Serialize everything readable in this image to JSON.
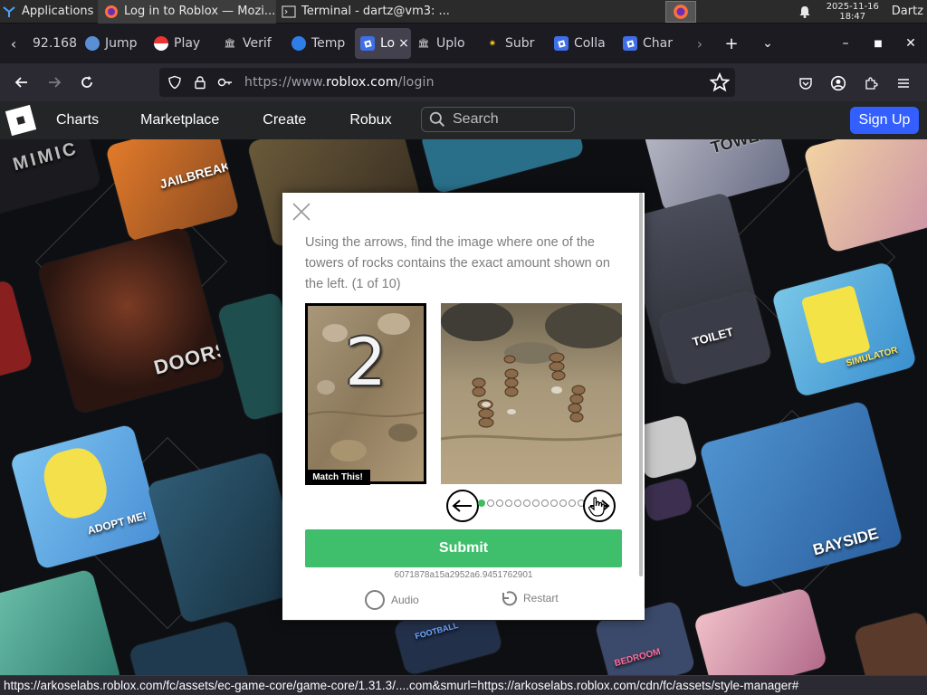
{
  "taskbar": {
    "app_menu_label": "Applications",
    "windows": [
      {
        "title": "Log in to Roblox — Mozi...",
        "icon": "firefox-icon",
        "active": true
      },
      {
        "title": "Terminal - dartz@vm3: ...",
        "icon": "terminal-icon",
        "active": false
      }
    ],
    "clock_date": "2025-11-16",
    "clock_time": "18:47",
    "user": "Dartz"
  },
  "tabs": [
    {
      "label": "92.168",
      "icon": "none"
    },
    {
      "label": "Jump",
      "icon": "globe-icon"
    },
    {
      "label": "Play",
      "icon": "pokeball-icon"
    },
    {
      "label": "Verif",
      "icon": "bank-icon"
    },
    {
      "label": "Temp",
      "icon": "cloud-icon"
    },
    {
      "label": "Lo",
      "icon": "roblox-icon",
      "active": true
    },
    {
      "label": "Uplo",
      "icon": "bank-icon"
    },
    {
      "label": "Subr",
      "icon": "star-icon"
    },
    {
      "label": "Colla",
      "icon": "roblox-icon"
    },
    {
      "label": "Char",
      "icon": "roblox-icon"
    }
  ],
  "navbar": {
    "url_prefix": "https://www.",
    "url_domain": "roblox.com",
    "url_path": "/login"
  },
  "roblox_header": {
    "nav_items": [
      "Charts",
      "Marketplace",
      "Create",
      "Robux"
    ],
    "search_placeholder": "Search",
    "signup_label": "Sign Up"
  },
  "background_labels": {
    "mimic": "MIMIC",
    "jailbreak": "JAILBREAK",
    "tower_heroes": "TOWER HEROES",
    "doors": "DOORS",
    "toilet": "TOILET",
    "adopt": "ADOPT ME!",
    "bayside": "BAYSIDE",
    "spongebob": "SIMULATOR",
    "football": "FOOTBALL",
    "bedroom": "BEDROOM"
  },
  "captcha": {
    "instructions": "Using the arrows, find the image where one of the towers of rocks contains the exact amount shown on the left. (1 of 10)",
    "reference_number": "2",
    "match_label": "Match This!",
    "total_steps": 10,
    "current_step": 1,
    "submit_label": "Submit",
    "session_id": "6071878a15a2952a6.9451762901",
    "audio_label": "Audio",
    "restart_label": "Restart"
  },
  "statusbar": {
    "text": "https://arkoselabs.roblox.com/fc/assets/ec-game-core/game-core/1.31.3/....com&smurl=https://arkoselabs.roblox.com/cdn/fc/assets/style-manager#"
  },
  "colors": {
    "roblox_blue": "#335fff",
    "captcha_green": "#3fbf6b",
    "dot_active": "#3ebd5e"
  }
}
